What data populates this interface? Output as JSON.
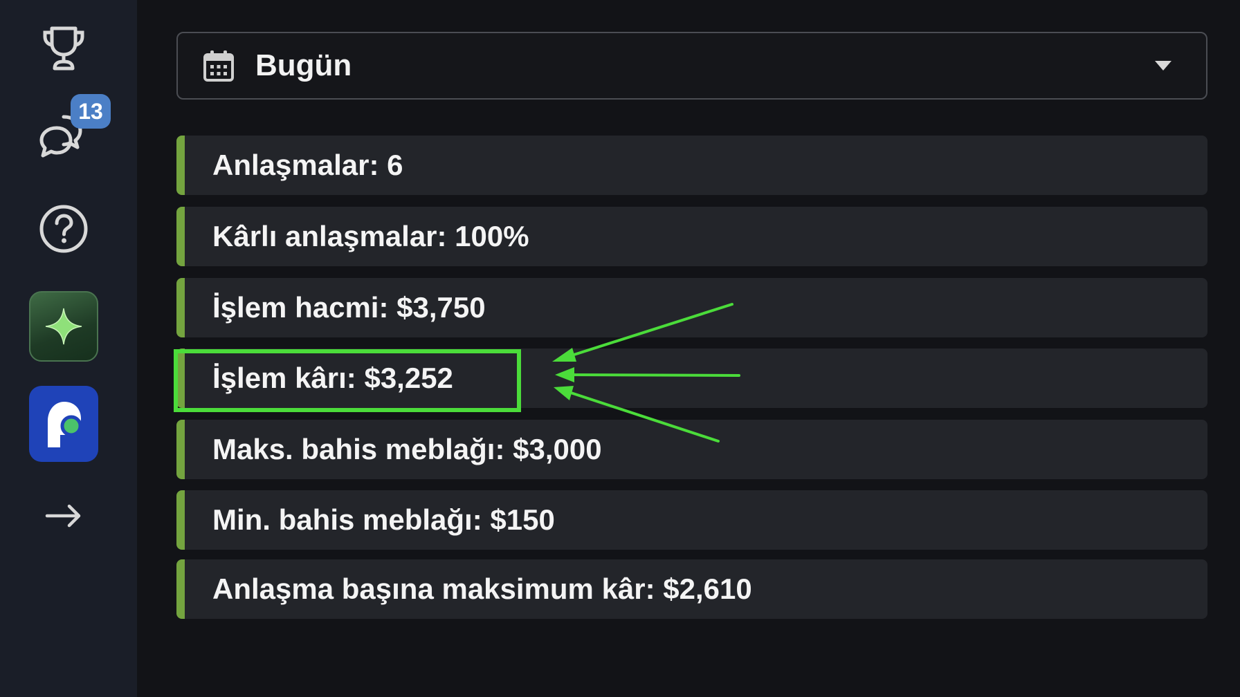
{
  "sidebar": {
    "items": [
      {
        "icon": "trophy-icon"
      },
      {
        "icon": "chat-bubbles-icon",
        "badge": "13"
      },
      {
        "icon": "help-circle-icon"
      },
      {
        "icon": "sparkle-icon"
      },
      {
        "icon": "app-logo-icon"
      },
      {
        "icon": "arrow-right-icon"
      }
    ]
  },
  "date_filter": {
    "icon": "calendar-icon",
    "selected": "Bugün"
  },
  "stats": [
    {
      "label": "Anlaşmalar: 6"
    },
    {
      "label": "Kârlı anlaşmalar: 100%"
    },
    {
      "label": "İşlem hacmi: $3,750"
    },
    {
      "label": "İşlem kârı: $3,252"
    },
    {
      "label": "Maks. bahis meblağı: $3,000"
    },
    {
      "label": "Min. bahis meblağı: $150"
    },
    {
      "label": "Anlaşma başına maksimum kâr: $2,610"
    }
  ],
  "colors": {
    "accent_bar": "#74a43f",
    "highlight": "#4bdc3a",
    "badge": "#4b7fc6",
    "app_logo_bg": "#1f43b8"
  }
}
